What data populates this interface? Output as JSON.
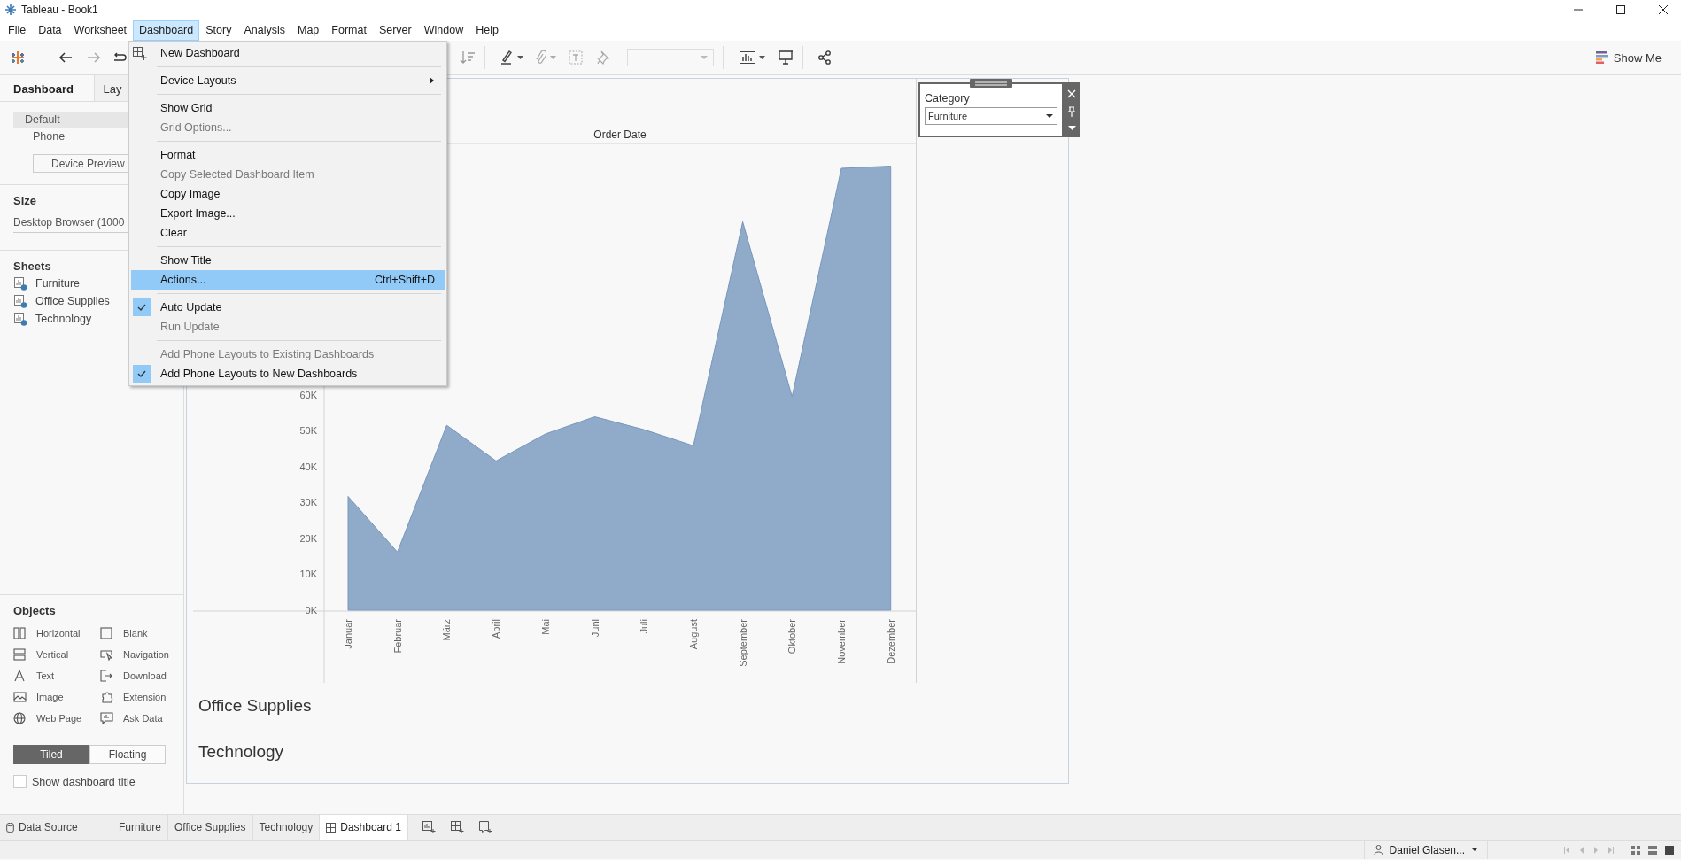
{
  "window": {
    "title": "Tableau - Book1"
  },
  "menu_bar": [
    {
      "label": "File",
      "selected": false
    },
    {
      "label": "Data",
      "selected": false
    },
    {
      "label": "Worksheet",
      "selected": false
    },
    {
      "label": "Dashboard",
      "selected": true
    },
    {
      "label": "Story",
      "selected": false
    },
    {
      "label": "Analysis",
      "selected": false
    },
    {
      "label": "Map",
      "selected": false
    },
    {
      "label": "Format",
      "selected": false
    },
    {
      "label": "Server",
      "selected": false
    },
    {
      "label": "Window",
      "selected": false
    },
    {
      "label": "Help",
      "selected": false
    }
  ],
  "toolbar": {
    "show_me": "Show Me"
  },
  "dashboard_menu": {
    "items": [
      {
        "kind": "item",
        "label": "New Dashboard",
        "has_icon": true,
        "submenu": false,
        "disabled": false,
        "checked": false,
        "selected": false
      },
      {
        "kind": "separator"
      },
      {
        "kind": "item",
        "label": "Device Layouts",
        "has_icon": false,
        "submenu": true,
        "disabled": false,
        "checked": false,
        "selected": false
      },
      {
        "kind": "separator"
      },
      {
        "kind": "item",
        "label": "Show Grid",
        "has_icon": false,
        "submenu": false,
        "disabled": false,
        "checked": false,
        "selected": false
      },
      {
        "kind": "item",
        "label": "Grid Options...",
        "has_icon": false,
        "submenu": false,
        "disabled": true,
        "checked": false,
        "selected": false
      },
      {
        "kind": "separator"
      },
      {
        "kind": "item",
        "label": "Format",
        "has_icon": false,
        "submenu": false,
        "disabled": false,
        "checked": false,
        "selected": false
      },
      {
        "kind": "item",
        "label": "Copy Selected Dashboard Item",
        "has_icon": false,
        "submenu": false,
        "disabled": true,
        "checked": false,
        "selected": false
      },
      {
        "kind": "item",
        "label": "Copy Image",
        "has_icon": false,
        "submenu": false,
        "disabled": false,
        "checked": false,
        "selected": false
      },
      {
        "kind": "item",
        "label": "Export Image...",
        "has_icon": false,
        "submenu": false,
        "disabled": false,
        "checked": false,
        "selected": false
      },
      {
        "kind": "item",
        "label": "Clear",
        "has_icon": false,
        "submenu": false,
        "disabled": false,
        "checked": false,
        "selected": false
      },
      {
        "kind": "separator"
      },
      {
        "kind": "item",
        "label": "Show Title",
        "has_icon": false,
        "submenu": false,
        "disabled": false,
        "checked": false,
        "selected": false
      },
      {
        "kind": "item",
        "label": "Actions...",
        "shortcut": "Ctrl+Shift+D",
        "has_icon": false,
        "submenu": false,
        "disabled": false,
        "checked": false,
        "selected": true
      },
      {
        "kind": "separator"
      },
      {
        "kind": "item",
        "label": "Auto Update",
        "has_icon": false,
        "submenu": false,
        "disabled": false,
        "checked": true,
        "selected": false
      },
      {
        "kind": "item",
        "label": "Run Update",
        "has_icon": false,
        "submenu": false,
        "disabled": true,
        "checked": false,
        "selected": false
      },
      {
        "kind": "separator"
      },
      {
        "kind": "item",
        "label": "Add Phone Layouts to Existing Dashboards",
        "has_icon": false,
        "submenu": false,
        "disabled": true,
        "checked": false,
        "selected": false
      },
      {
        "kind": "item",
        "label": "Add Phone Layouts to New Dashboards",
        "has_icon": false,
        "submenu": false,
        "disabled": false,
        "checked": true,
        "selected": false
      }
    ]
  },
  "left_panel": {
    "tabs": [
      {
        "label": "Dashboard",
        "selected": true
      },
      {
        "label": "Lay",
        "selected": false
      }
    ],
    "devices": [
      {
        "label": "Default",
        "selected": true
      },
      {
        "label": "Phone",
        "selected": false
      }
    ],
    "device_preview_button": "Device Preview",
    "size": {
      "heading": "Size",
      "value": "Desktop Browser (1000"
    },
    "sheets": {
      "heading": "Sheets",
      "items": [
        "Furniture",
        "Office Supplies",
        "Technology"
      ]
    },
    "objects": {
      "heading": "Objects",
      "items": [
        {
          "label": "Horizontal",
          "kind": "horizontal"
        },
        {
          "label": "Blank",
          "kind": "blank"
        },
        {
          "label": "Vertical",
          "kind": "vertical"
        },
        {
          "label": "Navigation",
          "kind": "navigation"
        },
        {
          "label": "Text",
          "kind": "text"
        },
        {
          "label": "Download",
          "kind": "download"
        },
        {
          "label": "Image",
          "kind": "image"
        },
        {
          "label": "Extension",
          "kind": "extension"
        },
        {
          "label": "Web Page",
          "kind": "web"
        },
        {
          "label": "Ask Data",
          "kind": "askdata"
        }
      ]
    },
    "layout_mode": [
      {
        "label": "Tiled",
        "selected": true
      },
      {
        "label": "Floating",
        "selected": false
      }
    ],
    "show_title": {
      "label": "Show dashboard title",
      "checked": false
    }
  },
  "canvas": {
    "sheet": {
      "chart_data": {
        "type": "area",
        "xlabel": "Order Date",
        "categories": [
          "Januar",
          "Februar",
          "März",
          "April",
          "Mai",
          "Juni",
          "Juli",
          "August",
          "September",
          "Oktober",
          "November",
          "Dezember"
        ],
        "series": [
          {
            "color": "#8fabc9",
            "values": [
              31700,
              16200,
              51500,
              41600,
              49100,
              53900,
              50300,
              45800,
              108200,
              59500,
              123100,
              123700
            ]
          }
        ],
        "ylim": [
          0,
          130000
        ],
        "yticks": [
          {
            "value": 0,
            "label": "0K"
          },
          {
            "value": 10000,
            "label": "10K"
          },
          {
            "value": 20000,
            "label": "20K"
          },
          {
            "value": 30000,
            "label": "30K"
          },
          {
            "value": 40000,
            "label": "40K"
          },
          {
            "value": 50000,
            "label": "50K"
          },
          {
            "value": 60000,
            "label": "60K"
          }
        ]
      }
    },
    "sheet_titles": [
      "Office Supplies",
      "Technology"
    ],
    "filter": {
      "title": "Category",
      "value": "Furniture"
    }
  },
  "sheet_tabs": [
    {
      "label": "Data Source",
      "kind": "datasource",
      "selected": false
    },
    {
      "label": "Furniture",
      "kind": "sheet",
      "selected": false
    },
    {
      "label": "Office Supplies",
      "kind": "sheet",
      "selected": false
    },
    {
      "label": "Technology",
      "kind": "sheet",
      "selected": false
    },
    {
      "label": "Dashboard 1",
      "kind": "dashboard",
      "selected": true
    }
  ],
  "status_bar": {
    "user": "Daniel Glasen..."
  }
}
